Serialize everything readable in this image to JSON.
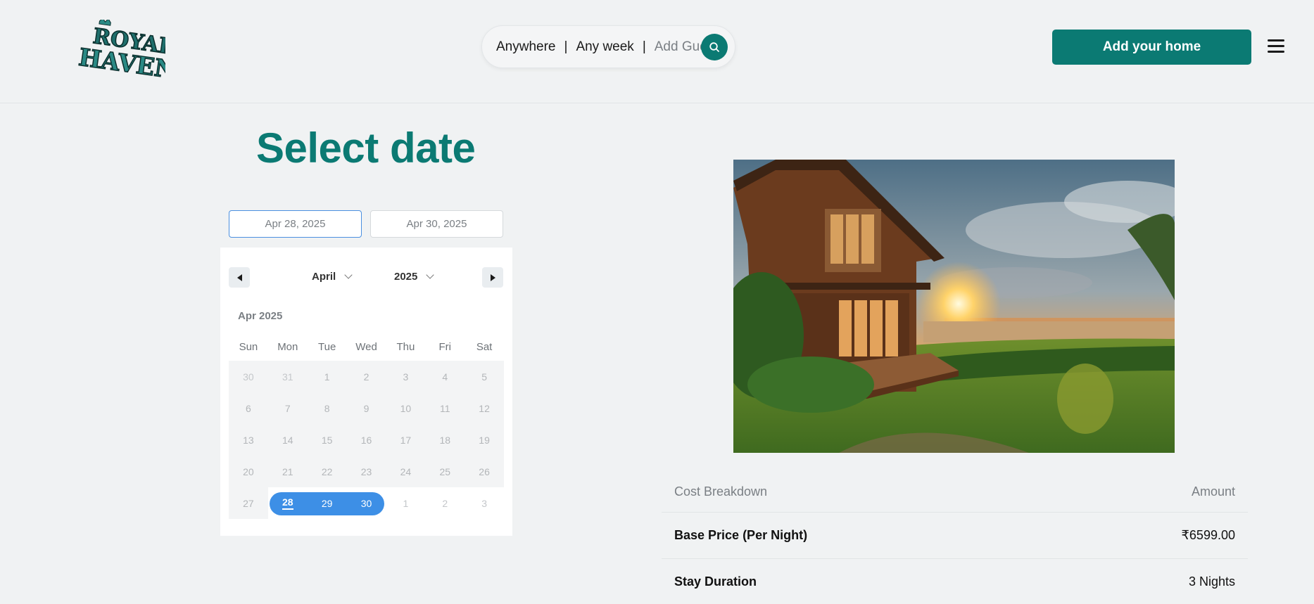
{
  "header": {
    "logo_alt": "Royal Haven",
    "search": {
      "location": "Anywhere",
      "week": "Any week",
      "guest_placeholder": "Add Guest",
      "separator": "|"
    },
    "add_home_label": "Add your home"
  },
  "booking": {
    "title": "Select date",
    "start_date": "Apr 28, 2025",
    "end_date": "Apr 30, 2025"
  },
  "calendar": {
    "month_select": "April",
    "year_select": "2025",
    "caption": "Apr 2025",
    "weekdays": [
      "Sun",
      "Mon",
      "Tue",
      "Wed",
      "Thu",
      "Fri",
      "Sat"
    ],
    "weeks": [
      [
        "30",
        "31",
        "1",
        "2",
        "3",
        "4",
        "5"
      ],
      [
        "6",
        "7",
        "8",
        "9",
        "10",
        "11",
        "12"
      ],
      [
        "13",
        "14",
        "15",
        "16",
        "17",
        "18",
        "19"
      ],
      [
        "20",
        "21",
        "22",
        "23",
        "24",
        "25",
        "26"
      ],
      [
        "27",
        "28",
        "29",
        "30",
        "1",
        "2",
        "3"
      ]
    ],
    "selected_start": "28",
    "selected_end": "30"
  },
  "cost": {
    "header_label": "Cost Breakdown",
    "header_amount": "Amount",
    "rows": [
      {
        "label": "Base Price (Per Night)",
        "amount": "₹6599.00"
      },
      {
        "label": "Stay Duration",
        "amount": "3 Nights"
      }
    ]
  },
  "colors": {
    "brand_teal": "#0b7a73",
    "range_blue": "#3d8fe6"
  }
}
